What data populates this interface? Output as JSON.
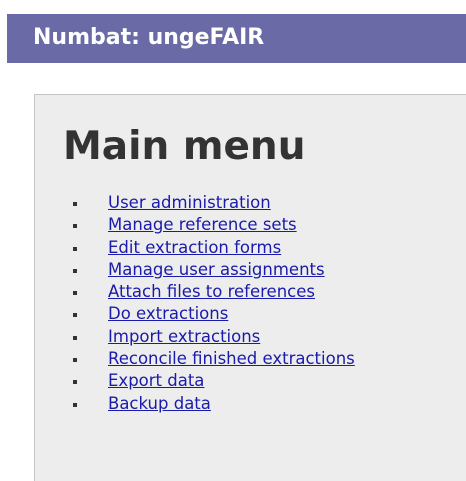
{
  "header": {
    "title": "Numbat: ungeFAIR"
  },
  "main": {
    "heading": "Main menu",
    "menu_items": [
      {
        "label": "User administration"
      },
      {
        "label": "Manage reference sets"
      },
      {
        "label": "Edit extraction forms"
      },
      {
        "label": "Manage user assignments"
      },
      {
        "label": "Attach files to references"
      },
      {
        "label": "Do extractions"
      },
      {
        "label": "Import extractions"
      },
      {
        "label": "Reconcile finished extractions"
      },
      {
        "label": "Export data"
      },
      {
        "label": "Backup data"
      }
    ]
  },
  "colors": {
    "header_bg": "#6a6aa6",
    "panel_bg": "#ededed",
    "link": "#1a1aab"
  }
}
